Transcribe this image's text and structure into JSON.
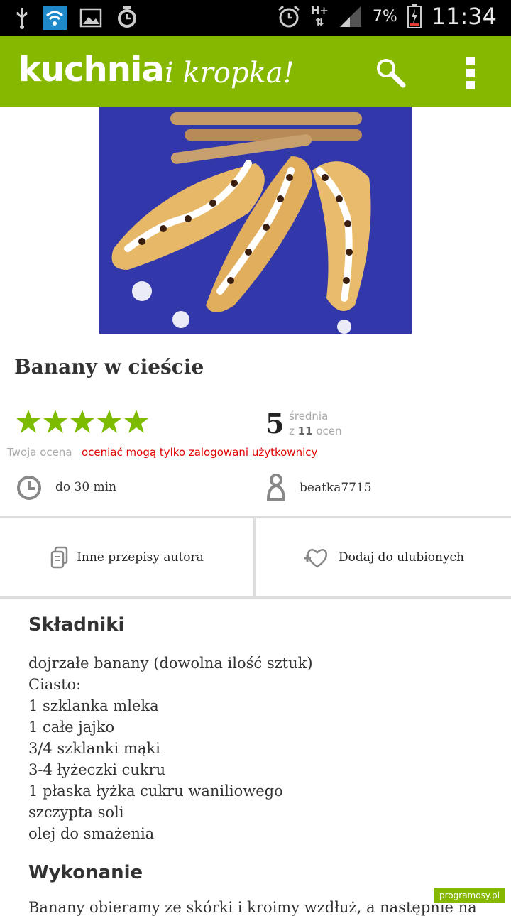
{
  "status_bar": {
    "battery_percent": "7%",
    "time": "11:34",
    "network": "H+",
    "icons": [
      "usb-icon",
      "wifi-icon",
      "gallery-icon",
      "alarm-icon",
      "alarm-clock-icon",
      "signal-icon",
      "battery-charging-icon"
    ]
  },
  "app_bar": {
    "brand_main": "kuchnia",
    "brand_sub": "i kropka!",
    "search_icon": "search-icon",
    "menu_icon": "overflow-menu-icon",
    "bg_color": "#86b800"
  },
  "recipe": {
    "title": "Banany w cieście",
    "rating": {
      "stars_filled": 5,
      "stars_total": 5,
      "average": "5",
      "average_label": "średnia",
      "count_prefix": "z",
      "count": "11",
      "count_suffix": "ocen",
      "your_rating_label": "Twoja ocena",
      "login_note": "oceniać mogą tylko zalogowani użytkownicy"
    },
    "time": "do 30 min",
    "author": "beatka7715"
  },
  "actions": {
    "other_recipes": "Inne przepisy autora",
    "add_favorite": "Dodaj do ulubionych"
  },
  "ingredients": {
    "heading": "Składniki",
    "items": [
      "dojrzałe banany (dowolna ilość sztuk)",
      "Ciasto:",
      "1 szklanka mleka",
      "1 całe jajko",
      "3/4 szklanki mąki",
      "3-4 łyżeczki cukru",
      "1 płaska łyżka cukru waniliowego",
      "szczypta soli",
      "olej do smażenia"
    ]
  },
  "preparation": {
    "heading": "Wykonanie",
    "first_line": "Banany obieramy ze skórki i kroimy wzdłuż, a następnie na"
  },
  "watermark": "programosy.pl",
  "colors": {
    "accent": "#86b800",
    "star": "#7dbb00",
    "error": "#e00000"
  }
}
